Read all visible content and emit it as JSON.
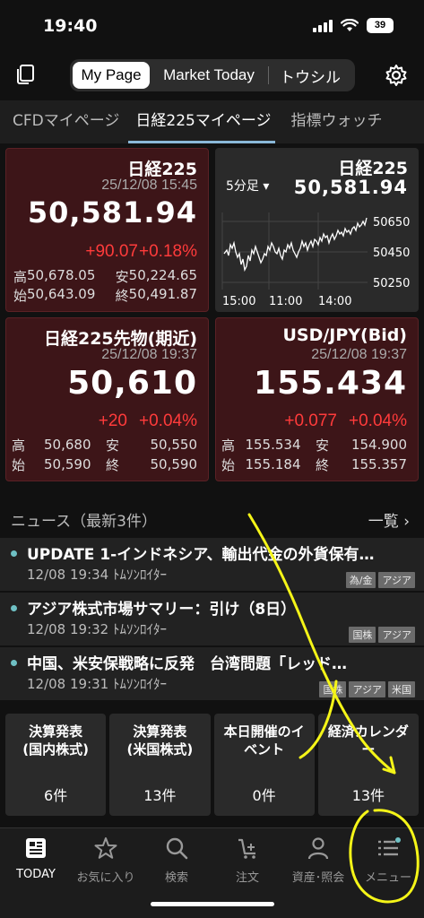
{
  "status_bar": {
    "time": "19:40",
    "battery": "39"
  },
  "top_nav": {
    "segments": [
      "My Page",
      "Market Today",
      "トウシル"
    ],
    "active_segment": "My Page"
  },
  "sub_tabs": {
    "items": [
      "CFDマイページ",
      "日経225マイページ",
      "指標ウォッチ"
    ],
    "active": "日経225マイページ"
  },
  "cards": {
    "nikkei": {
      "title": "日経225",
      "datetime": "25/12/08 15:45",
      "price": "50,581.94",
      "change": "+90.07",
      "change_pct": "+0.18%",
      "high_label": "高",
      "high": "50,678.05",
      "low_label": "安",
      "low": "50,224.65",
      "open_label": "始",
      "open": "50,643.09",
      "close_label": "終",
      "close": "50,491.87"
    },
    "nikkei_chart": {
      "title": "日経225",
      "interval": "5分足",
      "price": "50,581.94",
      "y_ticks": [
        "50650",
        "50450",
        "50250"
      ],
      "x_ticks": [
        "15:00",
        "11:00",
        "14:00"
      ]
    },
    "futures": {
      "title": "日経225先物(期近)",
      "datetime": "25/12/08 19:37",
      "price": "50,610",
      "change": "+20",
      "change_pct": "+0.04%",
      "high_label": "高",
      "high": "50,680",
      "low_label": "安",
      "low": "50,550",
      "open_label": "始",
      "open": "50,590",
      "close_label": "終",
      "close": "50,590"
    },
    "usdjpy": {
      "title": "USD/JPY(Bid)",
      "datetime": "25/12/08 19:37",
      "price": "155.434",
      "change": "+0.077",
      "change_pct": "+0.04%",
      "high_label": "高",
      "high": "155.534",
      "low_label": "安",
      "low": "154.900",
      "open_label": "始",
      "open": "155.184",
      "close_label": "終",
      "close": "155.357"
    }
  },
  "news": {
    "header": "ニュース（最新3件）",
    "more": "一覧 ›",
    "items": [
      {
        "title": "UPDATE 1-インドネシア、輸出代金の外貨保有…",
        "meta": "12/08 19:34 ﾄﾑｿﾝﾛｲﾀｰ",
        "tags": [
          "為/金",
          "アジア"
        ]
      },
      {
        "title": "アジア株式市場サマリー：引け（8日）",
        "meta": "12/08 19:32 ﾄﾑｿﾝﾛｲﾀｰ",
        "tags": [
          "国株",
          "アジア"
        ]
      },
      {
        "title": "中国、米安保戦略に反発　台湾問題「レッド…",
        "meta": "12/08 19:31 ﾄﾑｿﾝﾛｲﾀｰ",
        "tags": [
          "国株",
          "アジア",
          "米国"
        ]
      }
    ]
  },
  "tiles": [
    {
      "line1": "決算発表",
      "line2": "(国内株式)",
      "count": "6件"
    },
    {
      "line1": "決算発表",
      "line2": "(米国株式)",
      "count": "13件"
    },
    {
      "line1": "本日開催のイ",
      "line2": "ベント",
      "count": "0件"
    },
    {
      "line1": "経済カレンダ",
      "line2": "ー",
      "count": "13件"
    }
  ],
  "tabbar": {
    "items": [
      {
        "label": "TODAY",
        "icon": "newspaper-icon"
      },
      {
        "label": "お気に入り",
        "icon": "star-icon"
      },
      {
        "label": "検索",
        "icon": "search-icon"
      },
      {
        "label": "注文",
        "icon": "cart-icon"
      },
      {
        "label": "資産･照会",
        "icon": "person-icon"
      },
      {
        "label": "メニュー",
        "icon": "menu-icon"
      }
    ],
    "active": "TODAY"
  },
  "colors": {
    "up": "#ff3b3b",
    "accent": "#8ab8d8",
    "annotation": "#f5f518",
    "card_red": "#3d1518"
  }
}
